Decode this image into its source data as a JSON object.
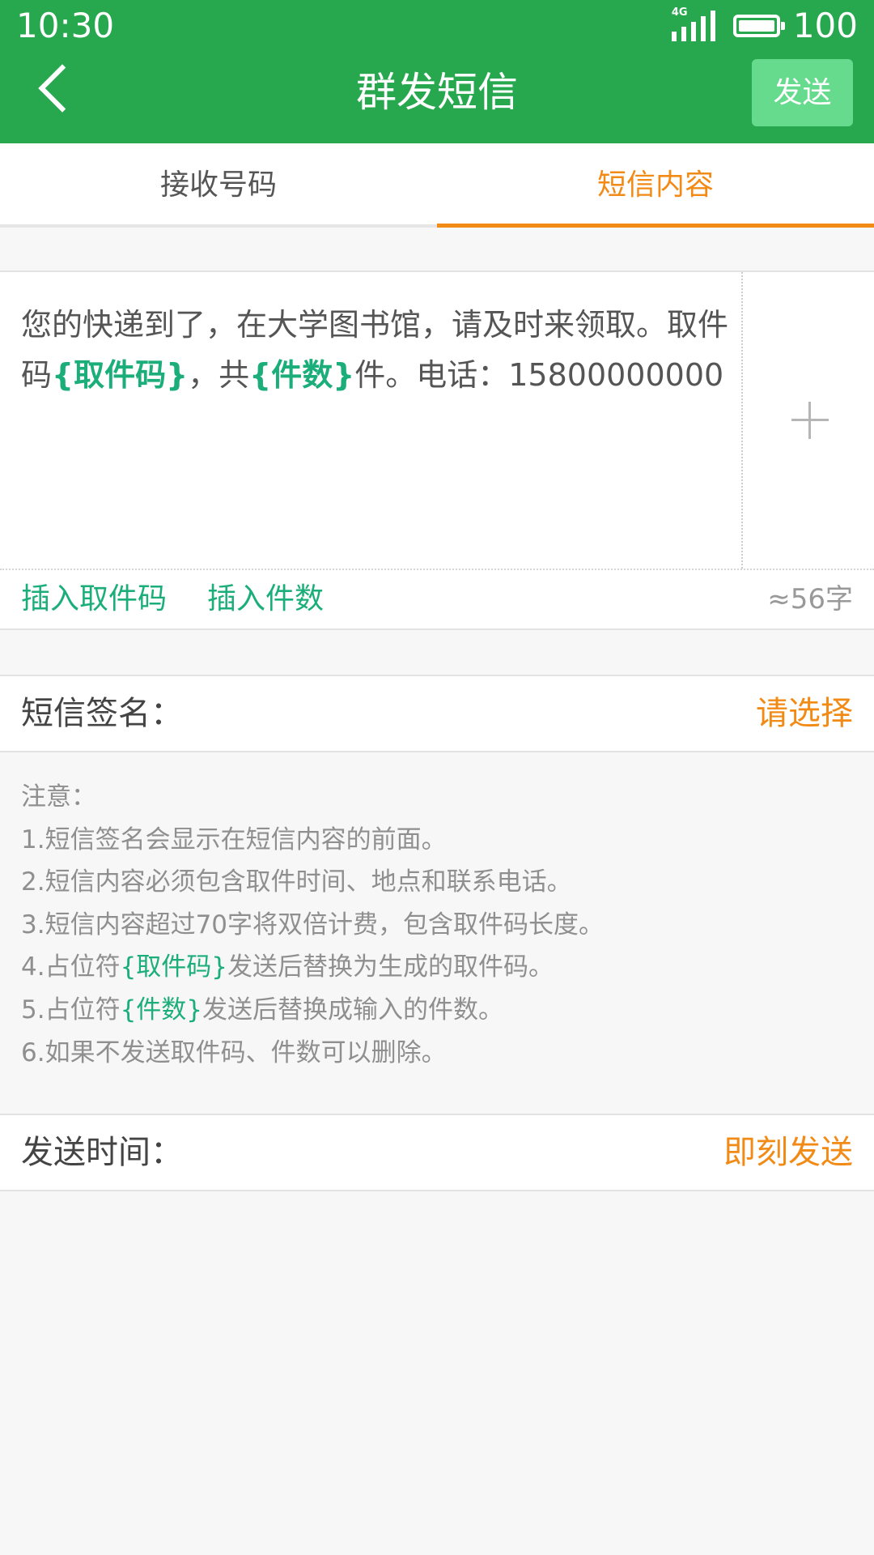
{
  "status_bar": {
    "time": "10:30",
    "network": "4G",
    "battery": "100",
    "battery_level_fraction": 1.0
  },
  "header": {
    "title": "群发短信",
    "send_label": "发送",
    "background_color": "#27a84e"
  },
  "tabs": [
    {
      "label": "接收号码",
      "active": false
    },
    {
      "label": "短信内容",
      "active": true
    }
  ],
  "message": {
    "part1": "您的快递到了，在大学图书馆，请及时来领取。取件码",
    "token_code": "{取件码}",
    "part2": "，共",
    "token_count": "{件数}",
    "part3": "件。电话：15800000000"
  },
  "insert_actions": {
    "insert_code": "插入取件码",
    "insert_count": "插入件数"
  },
  "char_count": "≈56字",
  "signature": {
    "label": "短信签名：",
    "value": "请选择"
  },
  "notes": {
    "heading": "注意：",
    "line1": "1.短信签名会显示在短信内容的前面。",
    "line2": "2.短信内容必须包含取件时间、地点和联系电话。",
    "line3": "3.短信内容超过70字将双倍计费，包含取件码长度。",
    "line4_prefix": "4.占位符",
    "line4_token": "{取件码}",
    "line4_suffix": "发送后替换为生成的取件码。",
    "line5_prefix": "5.占位符",
    "line5_token": "{件数}",
    "line5_suffix": "发送后替换成输入的件数。",
    "line6": "6.如果不发送取件码、件数可以删除。"
  },
  "send_time": {
    "label": "发送时间：",
    "value": "即刻发送"
  },
  "colors": {
    "accent_orange": "#f28a16",
    "token_green": "#1bae7a",
    "send_button_green": "#66db8e"
  },
  "icons": [
    "back-arrow-icon",
    "signal-icon",
    "battery-icon",
    "plus-icon"
  ]
}
